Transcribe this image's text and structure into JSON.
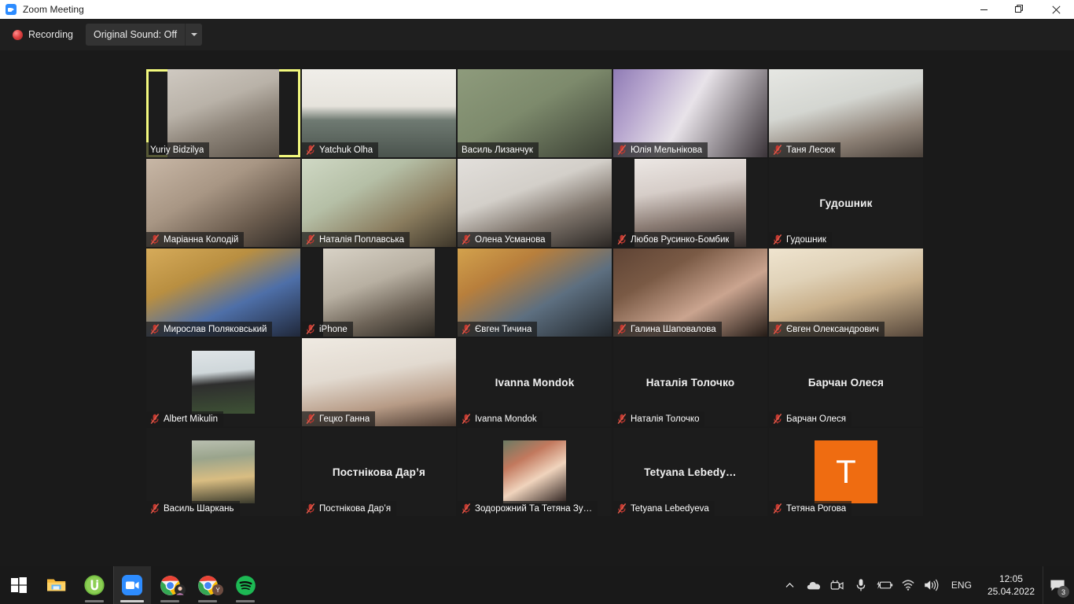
{
  "window": {
    "title": "Zoom Meeting",
    "app_icon": "zoom-video-icon",
    "minimize_label": "Minimize",
    "maximize_label": "Restore",
    "close_label": "Close"
  },
  "toolbar": {
    "recording_label": "Recording",
    "recording_icon": "record-dot-icon",
    "original_sound_label": "Original Sound: Off",
    "original_sound_caret_icon": "chevron-down-icon"
  },
  "gallery": {
    "mic_muted_icon": "microphone-muted-icon",
    "tiles": [
      {
        "name": "Yuriy Bidzilya",
        "muted": false,
        "active": true,
        "mode": "video",
        "center_name": "",
        "skin": "s1",
        "pillar": true
      },
      {
        "name": "Yatchuk Olha",
        "muted": true,
        "active": false,
        "mode": "video",
        "center_name": "",
        "skin": "s2",
        "pillar": false
      },
      {
        "name": "Василь Лизанчук",
        "muted": false,
        "active": false,
        "mode": "video",
        "center_name": "",
        "skin": "s3",
        "pillar": false
      },
      {
        "name": "Юлія Мельнікова",
        "muted": true,
        "active": false,
        "mode": "video",
        "center_name": "",
        "skin": "s4",
        "pillar": false
      },
      {
        "name": "Таня Лесюк",
        "muted": true,
        "active": false,
        "mode": "video",
        "center_name": "",
        "skin": "s5",
        "pillar": false
      },
      {
        "name": "Маріанна Колодій",
        "muted": true,
        "active": false,
        "mode": "video",
        "center_name": "",
        "skin": "s6",
        "pillar": false
      },
      {
        "name": "Наталія Поплавська",
        "muted": true,
        "active": false,
        "mode": "video",
        "center_name": "",
        "skin": "s7",
        "pillar": false
      },
      {
        "name": "Олена Усманова",
        "muted": true,
        "active": false,
        "mode": "video",
        "center_name": "",
        "skin": "s8",
        "pillar": false
      },
      {
        "name": "Любов Русинко-Бомбик",
        "muted": true,
        "active": false,
        "mode": "video",
        "center_name": "",
        "skin": "s9",
        "pillar": true
      },
      {
        "name": "Гудошник",
        "muted": true,
        "active": false,
        "mode": "name",
        "center_name": "Гудошник",
        "skin": "",
        "pillar": false
      },
      {
        "name": "Мирослав Поляковський",
        "muted": true,
        "active": false,
        "mode": "video",
        "center_name": "",
        "skin": "s10",
        "pillar": false
      },
      {
        "name": "iPhone",
        "muted": true,
        "active": false,
        "mode": "video",
        "center_name": "",
        "skin": "s11",
        "pillar": true
      },
      {
        "name": "Євген Тичина",
        "muted": true,
        "active": false,
        "mode": "video",
        "center_name": "",
        "skin": "s12",
        "pillar": false
      },
      {
        "name": "Галина Шаповалова",
        "muted": true,
        "active": false,
        "mode": "video",
        "center_name": "",
        "skin": "s13",
        "pillar": false
      },
      {
        "name": "Євген Олександрович",
        "muted": true,
        "active": false,
        "mode": "video",
        "center_name": "",
        "skin": "s14",
        "pillar": false
      },
      {
        "name": "Albert Mikulin",
        "muted": true,
        "active": false,
        "mode": "photo",
        "center_name": "",
        "skin": "p1",
        "pillar": false
      },
      {
        "name": "Гецко Ганна",
        "muted": true,
        "active": false,
        "mode": "video",
        "center_name": "",
        "skin": "s15",
        "pillar": false
      },
      {
        "name": "Ivanna Mondok",
        "muted": true,
        "active": false,
        "mode": "name",
        "center_name": "Ivanna Mondok",
        "skin": "",
        "pillar": false
      },
      {
        "name": "Наталія Толочко",
        "muted": true,
        "active": false,
        "mode": "name",
        "center_name": "Наталія Толочко",
        "skin": "",
        "pillar": false
      },
      {
        "name": "Барчан Олеся",
        "muted": true,
        "active": false,
        "mode": "name",
        "center_name": "Барчан Олеся",
        "skin": "",
        "pillar": false
      },
      {
        "name": "Василь Шаркань",
        "muted": true,
        "active": false,
        "mode": "photo",
        "center_name": "",
        "skin": "p2",
        "pillar": false
      },
      {
        "name": "Постнікова Дар’я",
        "muted": true,
        "active": false,
        "mode": "name",
        "center_name": "Постнікова Дар’я",
        "skin": "",
        "pillar": false
      },
      {
        "name": "Зодорожний Та Тетяна Зу…",
        "muted": true,
        "active": false,
        "mode": "photo",
        "center_name": "",
        "skin": "p3",
        "pillar": false
      },
      {
        "name": "Tetyana Lebedyeva",
        "muted": true,
        "active": false,
        "mode": "name",
        "center_name": "Tetyana  Lebedy…",
        "skin": "",
        "pillar": false
      },
      {
        "name": "Тетяна Рогова",
        "muted": true,
        "active": false,
        "mode": "letter",
        "center_name": "",
        "skin": "T",
        "pillar": false
      }
    ]
  },
  "taskbar": {
    "items": [
      {
        "icon": "windows-start-icon",
        "label": "Start",
        "active": false,
        "open": false
      },
      {
        "icon": "file-explorer-icon",
        "label": "File Explorer",
        "active": false,
        "open": false
      },
      {
        "icon": "utorrent-icon",
        "label": "uTorrent",
        "active": false,
        "open": true
      },
      {
        "icon": "zoom-icon",
        "label": "Zoom Meeting",
        "active": true,
        "open": true
      },
      {
        "icon": "chrome-icon",
        "label": "Google Chrome",
        "active": false,
        "open": true
      },
      {
        "icon": "chrome-icon",
        "label": "Google Chrome",
        "active": false,
        "open": true
      },
      {
        "icon": "spotify-icon",
        "label": "Spotify",
        "active": false,
        "open": true
      }
    ],
    "tray": [
      {
        "icon": "chevron-up-icon",
        "label": "Show hidden icons"
      },
      {
        "icon": "onedrive-cloud-icon",
        "label": "OneDrive"
      },
      {
        "icon": "camera-icon",
        "label": "Camera in use"
      },
      {
        "icon": "microphone-icon",
        "label": "Microphone in use"
      },
      {
        "icon": "battery-charging-icon",
        "label": "Battery"
      },
      {
        "icon": "wifi-icon",
        "label": "Network"
      },
      {
        "icon": "volume-icon",
        "label": "Volume"
      }
    ],
    "language": "ENG",
    "clock_time": "12:05",
    "clock_date": "25.04.2022",
    "notifications_icon": "action-center-icon",
    "notifications_count": "3"
  },
  "colors": {
    "accent_active_border": "#f3f97e",
    "recording_red": "#e04545",
    "muted_red": "#c1372f",
    "zoom_blue": "#2d8cff",
    "letter_avatar_orange": "#ef6c11",
    "taskbar_bg": "#191919",
    "toolbar_bg": "#1f1f1f",
    "gallery_bg": "#1a1a1a"
  }
}
